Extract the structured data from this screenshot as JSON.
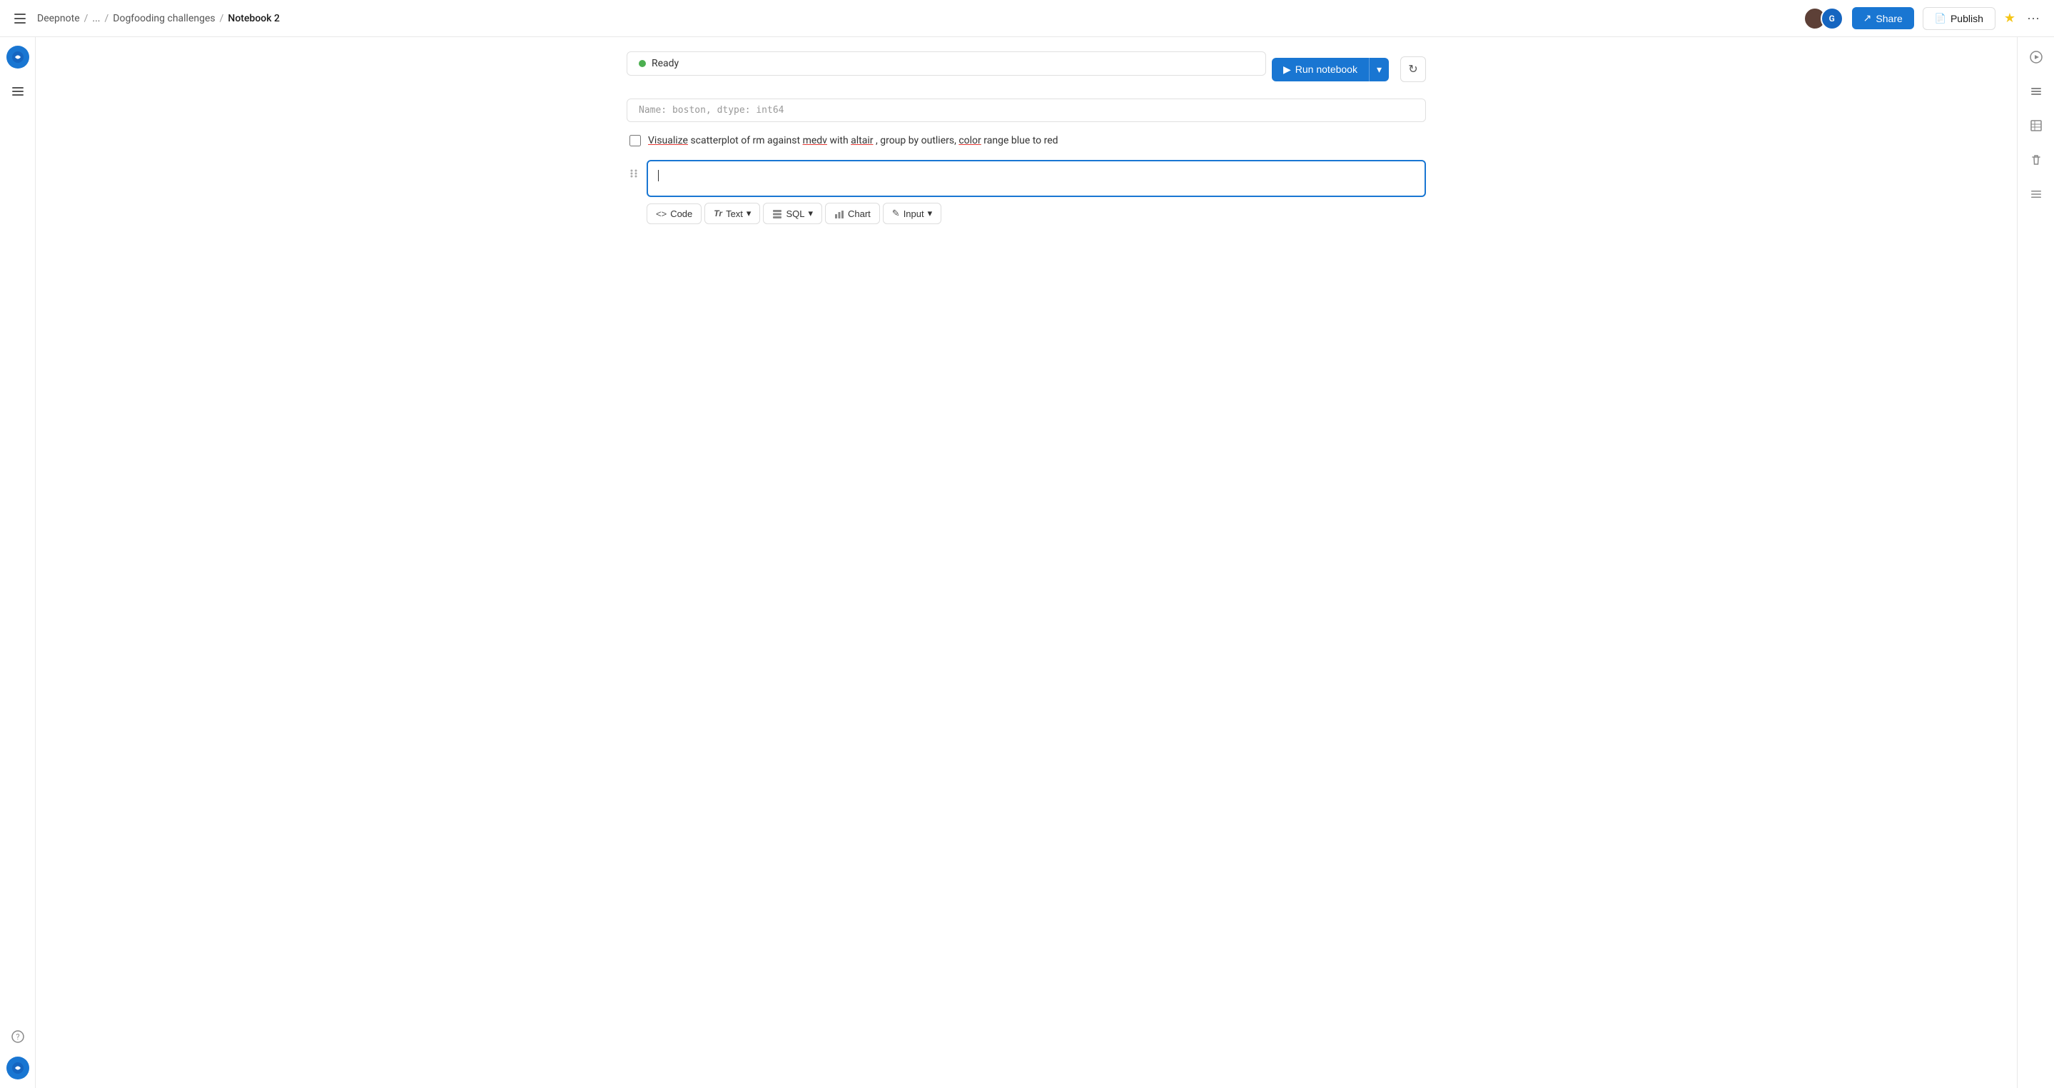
{
  "topbar": {
    "menu_icon_label": "menu",
    "breadcrumb": {
      "home": "Deepnote",
      "sep1": "/",
      "ellipsis": "...",
      "sep2": "/",
      "parent": "Dogfooding challenges",
      "sep3": "/",
      "current": "Notebook 2"
    },
    "share_label": "Share",
    "publish_label": "Publish",
    "star_char": "★",
    "more_char": "···"
  },
  "left_sidebar": {
    "logo_char": "↺",
    "icons": [
      "≡"
    ]
  },
  "status_bar": {
    "dot_color": "#4caf50",
    "status_text": "Ready",
    "run_label": "Run notebook",
    "run_arrow": "▸",
    "dropdown_arrow": "▾",
    "refresh_char": "↻"
  },
  "faded_cell": {
    "text": "Name: boston, dtype: int64"
  },
  "checkbox_row": {
    "label": "Visualize scatterplot of rm against medv with altair, group by outliers, color range blue to red",
    "underlined_words": [
      "Visualize",
      "medv",
      "altair",
      "color"
    ]
  },
  "active_cell": {
    "placeholder": ""
  },
  "cell_toolbar": {
    "buttons": [
      {
        "id": "code",
        "icon": "<>",
        "label": "Code"
      },
      {
        "id": "text",
        "icon": "Tr",
        "label": "Text",
        "has_arrow": true
      },
      {
        "id": "sql",
        "icon": "≡",
        "label": "SQL",
        "has_arrow": true
      },
      {
        "id": "chart",
        "icon": "▦",
        "label": "Chart"
      },
      {
        "id": "input",
        "icon": "✎",
        "label": "Input",
        "has_arrow": true
      }
    ]
  },
  "right_sidebar": {
    "icons": [
      "▶",
      "⊟",
      "⊞",
      "⊟",
      "≡"
    ]
  },
  "colors": {
    "accent_blue": "#1976d2",
    "ready_green": "#4caf50",
    "underline_red": "#e53935"
  }
}
